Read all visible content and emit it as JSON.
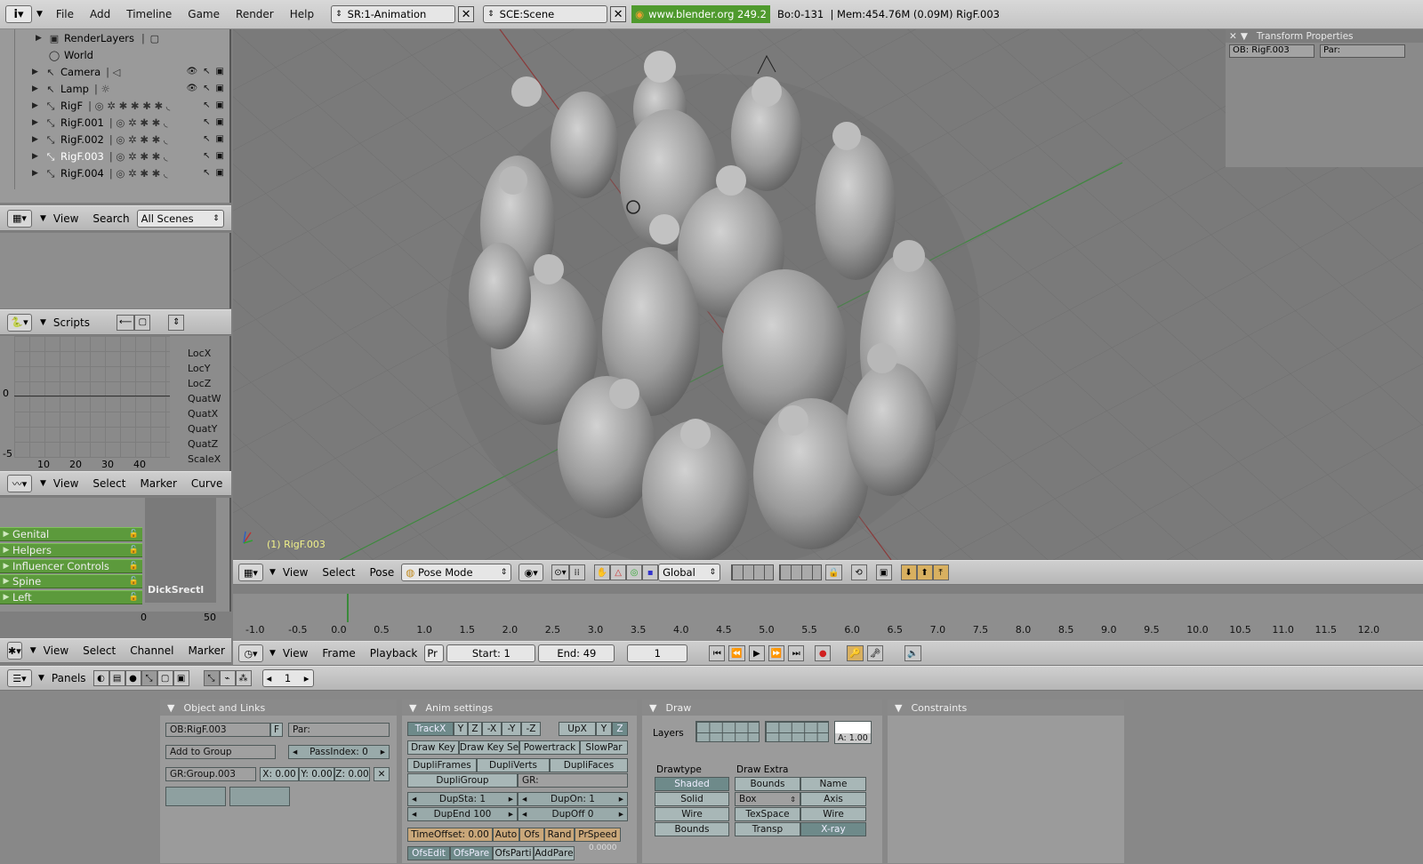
{
  "topbar": {
    "menus": [
      "File",
      "Add",
      "Timeline",
      "Game",
      "Render",
      "Help"
    ],
    "screen": "SR:1-Animation",
    "scene": "SCE:Scene",
    "url": "www.blender.org 249.2",
    "stats": "Bo:0-131  | Mem:454.76M (0.09M) RigF.003"
  },
  "outliner": {
    "rows": [
      "RenderLayers",
      "World",
      "Camera",
      "Lamp",
      "RigF",
      "RigF.001",
      "RigF.002",
      "RigF.003",
      "RigF.004"
    ],
    "header": {
      "view": "View",
      "search": "Search",
      "scenes": "All Scenes"
    }
  },
  "scripts": {
    "label": "Scripts"
  },
  "ipo": {
    "yLabels": [
      "0",
      "-5"
    ],
    "xLabels": [
      "10",
      "20",
      "30",
      "40"
    ],
    "channels": [
      "LocX",
      "LocY",
      "LocZ",
      "QuatW",
      "QuatX",
      "QuatY",
      "QuatZ",
      "ScaleX"
    ],
    "header": {
      "view": "View",
      "select": "Select",
      "marker": "Marker",
      "curve": "Curve"
    }
  },
  "action": {
    "channels": [
      "Genital",
      "Helpers",
      "Influencer Controls",
      "Spine",
      "Left"
    ],
    "strip": "DickSrectl",
    "xLabels": [
      "0",
      "50"
    ],
    "header": {
      "view": "View",
      "select": "Select",
      "channel": "Channel",
      "marker": "Marker"
    }
  },
  "viewport": {
    "objectLabel": "(1) RigF.003",
    "header": {
      "view": "View",
      "select": "Select",
      "pose": "Pose",
      "mode": "Pose Mode",
      "orientation": "Global"
    }
  },
  "transformProps": {
    "title": "Transform Properties",
    "ob": "OB: RigF.003",
    "par": "Par:"
  },
  "timeline": {
    "ticks": [
      "-1.0",
      "-0.5",
      "0.0",
      "0.5",
      "1.0",
      "1.5",
      "2.0",
      "2.5",
      "3.0",
      "3.5",
      "4.0",
      "4.5",
      "5.0",
      "5.5",
      "6.0",
      "6.5",
      "7.0",
      "7.5",
      "8.0",
      "8.5",
      "9.0",
      "9.5",
      "10.0",
      "10.5",
      "11.0",
      "11.5",
      "12.0"
    ],
    "header": {
      "view": "View",
      "frame": "Frame",
      "playback": "Playback",
      "pr": "Pr",
      "start": "Start: 1",
      "end": "End: 49",
      "current": "1"
    }
  },
  "buttons": {
    "header": {
      "panels": "Panels",
      "frame": "1"
    },
    "objectLinks": {
      "title": "Object and Links",
      "ob": "OB:RigF.003",
      "f": "F",
      "par": "Par:",
      "addGroup": "Add to Group",
      "passIndex": "PassIndex: 0",
      "group": "GR:Group.003",
      "x": "X: 0.00",
      "y": "Y: 0.00",
      "z": "Z: 0.00"
    },
    "anim": {
      "title": "Anim settings",
      "track": [
        "TrackX",
        "Y",
        "Z",
        "-X",
        "-Y",
        "-Z"
      ],
      "up": [
        "UpX",
        "Y",
        "Z"
      ],
      "row2": [
        "Draw Key",
        "Draw Key Se",
        "Powertrack",
        "SlowPar"
      ],
      "row3": [
        "DupliFrames",
        "DupliVerts",
        "DupliFaces"
      ],
      "dupliGroup": "DupliGroup",
      "gr": "GR:",
      "dupSta": "DupSta: 1",
      "dupOn": "DupOn: 1",
      "dupEnd": "DupEnd 100",
      "dupOff": "DupOff 0",
      "timeOffset": "TimeOffset: 0.00",
      "row6": [
        "Auto",
        "Ofs",
        "Rand",
        "PrSpeed"
      ],
      "row7": [
        "OfsEdit",
        "OfsPare",
        "OfsParti",
        "AddPare"
      ],
      "val": "0.0000"
    },
    "draw": {
      "title": "Draw",
      "layers": "Layers",
      "alpha": "A: 1.00",
      "drawtype": "Drawtype",
      "drawExtra": "Draw Extra",
      "types": [
        "Shaded",
        "Solid",
        "Wire",
        "Bounds"
      ],
      "extraLeft": [
        "Bounds",
        "Box",
        "TexSpace",
        "Transp"
      ],
      "extraRight": [
        "Name",
        "Axis",
        "Wire",
        "X-ray"
      ]
    },
    "constraints": {
      "title": "Constraints"
    }
  }
}
